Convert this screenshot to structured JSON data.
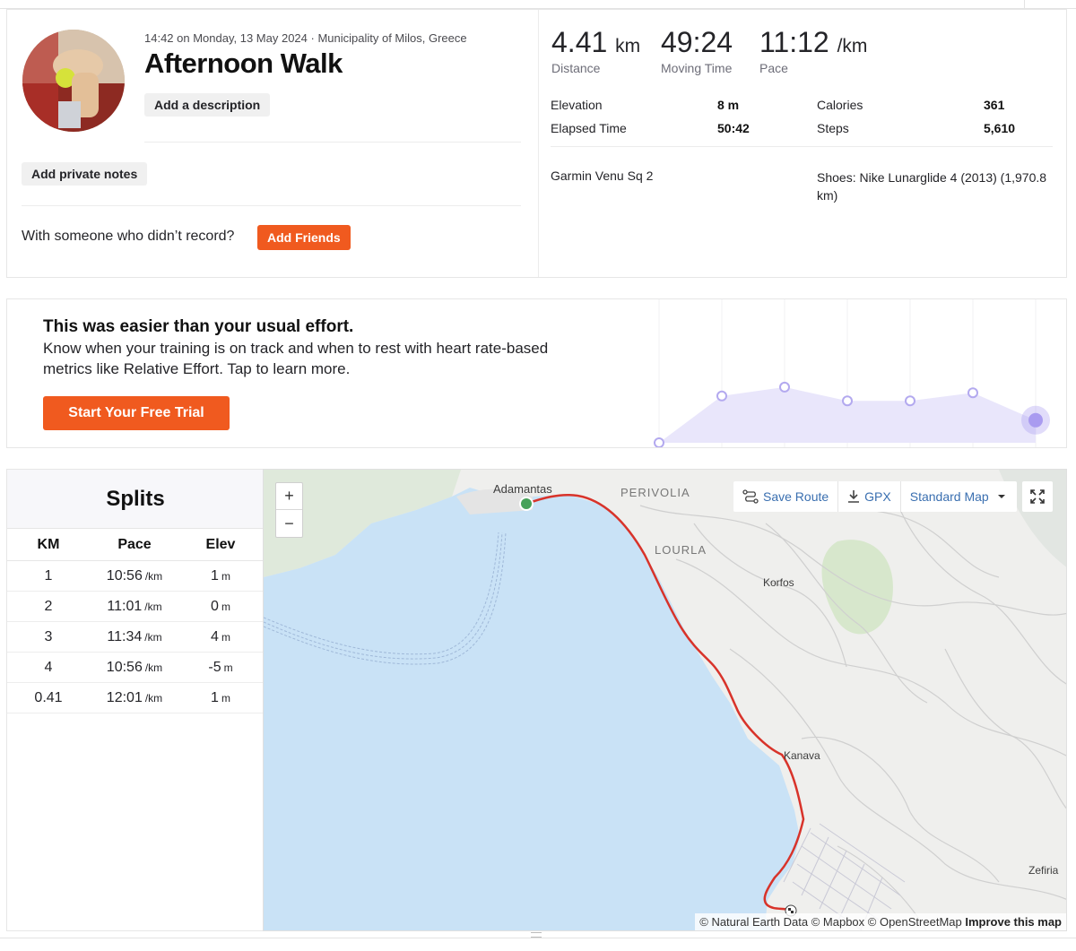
{
  "activity": {
    "meta": "14:42 on Monday, 13 May 2024 · Municipality of Milos, Greece",
    "title": "Afternoon Walk",
    "add_description": "Add a description",
    "add_private_notes": "Add private notes",
    "friends_prompt": "With someone who didn’t record?",
    "add_friends": "Add Friends"
  },
  "stats": {
    "distance": {
      "value": "4.41",
      "unit": "km",
      "label": "Distance"
    },
    "moving_time": {
      "value": "49:24",
      "label": "Moving Time"
    },
    "pace": {
      "value": "11:12",
      "unit": "/km",
      "label": "Pace"
    },
    "elevation": {
      "label": "Elevation",
      "value": "8 m"
    },
    "elapsed": {
      "label": "Elapsed Time",
      "value": "50:42"
    },
    "calories": {
      "label": "Calories",
      "value": "361"
    },
    "steps": {
      "label": "Steps",
      "value": "5,610"
    },
    "device": "Garmin Venu Sq 2",
    "shoes": "Shoes: Nike Lunarglide 4 (2013) (1,970.8 km)"
  },
  "effort": {
    "heading": "This was easier than your usual effort.",
    "body": "Know when your training is on track and when to rest with heart rate-based metrics like Relative Effort. Tap to learn more.",
    "cta": "Start Your Free Trial",
    "points": [
      0,
      0.58,
      0.69,
      0.52,
      0.52,
      0.62,
      0.28
    ],
    "colors": {
      "fill": "#e9e6fb",
      "stroke": "#b3a9ef",
      "highlight": "#a99bf0"
    }
  },
  "splits": {
    "title": "Splits",
    "headers": {
      "km": "KM",
      "pace": "Pace",
      "elev": "Elev"
    },
    "pace_unit": "/km",
    "elev_unit": "m",
    "rows": [
      {
        "km": "1",
        "pace": "10:56",
        "elev": "1"
      },
      {
        "km": "2",
        "pace": "11:01",
        "elev": "0"
      },
      {
        "km": "3",
        "pace": "11:34",
        "elev": "4"
      },
      {
        "km": "4",
        "pace": "10:56",
        "elev": "-5"
      },
      {
        "km": "0.41",
        "pace": "12:01",
        "elev": "1"
      }
    ]
  },
  "map": {
    "zoom_in": "+",
    "zoom_out": "−",
    "save_route": "Save Route",
    "gpx": "GPX",
    "map_type": "Standard Map",
    "labels": {
      "adamantas": "Adamantas",
      "perivolia": "PERIVOLIA",
      "lourla": "LOURLA",
      "korfos": "Korfos",
      "kanava": "Kanava",
      "zefiria": "Zefiria"
    },
    "attribution": "© Natural Earth Data © Mapbox © OpenStreetMap",
    "improve": "Improve this map",
    "colors": {
      "water": "#c9e2f6",
      "land": "#efefed",
      "route": "#d8332a",
      "start": "#47a25a"
    }
  }
}
